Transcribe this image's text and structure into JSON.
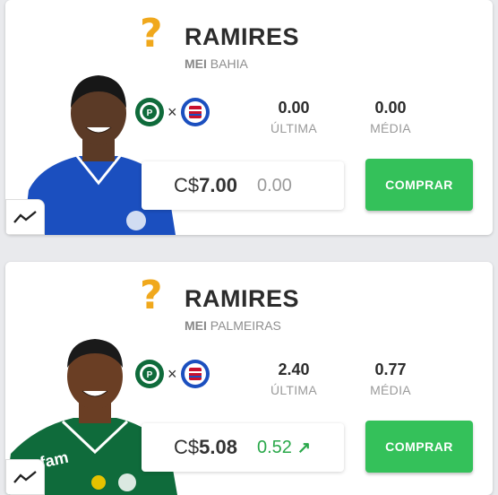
{
  "colors": {
    "status_unknown": "#f0a81c",
    "buy_button": "#34c15a",
    "positive_variation": "#2aa84a",
    "bahia_jersey": "#1b4fbf",
    "palmeiras_jersey": "#0f6b3b"
  },
  "players": [
    {
      "status_icon": "question-mark-icon",
      "status_symbol": "?",
      "name": "RAMIRES",
      "position": "MEI",
      "club": "BAHIA",
      "match": {
        "home_crest": "palmeiras-crest-icon",
        "vs": "×",
        "away_crest": "bahia-crest-icon"
      },
      "last_score": "0.00",
      "last_label": "ÚLTIMA",
      "average": "0.00",
      "average_label": "MÉDIA",
      "price_currency": "C$",
      "price_amount": "7.00",
      "variation": "0.00",
      "buy_label": "COMPRAR"
    },
    {
      "status_icon": "question-mark-icon",
      "status_symbol": "?",
      "name": "RAMIRES",
      "position": "MEI",
      "club": "PALMEIRAS",
      "match": {
        "home_crest": "palmeiras-crest-icon",
        "vs": "×",
        "away_crest": "bahia-crest-icon"
      },
      "last_score": "2.40",
      "last_label": "ÚLTIMA",
      "average": "0.77",
      "average_label": "MÉDIA",
      "price_currency": "C$",
      "price_amount": "5.08",
      "variation": "0.52",
      "variation_icon": "arrow-up-right-icon",
      "buy_label": "COMPRAR"
    }
  ]
}
